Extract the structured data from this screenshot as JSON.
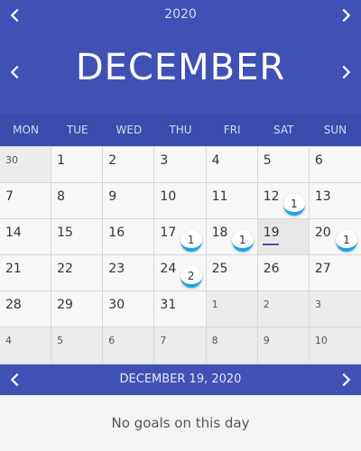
{
  "header": {
    "year": "2020",
    "month": "DECEMBER",
    "weekdays": [
      "MON",
      "TUE",
      "WED",
      "THU",
      "FRI",
      "SAT",
      "SUN"
    ]
  },
  "calendar": {
    "cells": [
      {
        "day": "30",
        "other": true
      },
      {
        "day": "1"
      },
      {
        "day": "2"
      },
      {
        "day": "3"
      },
      {
        "day": "4"
      },
      {
        "day": "5"
      },
      {
        "day": "6"
      },
      {
        "day": "7"
      },
      {
        "day": "8"
      },
      {
        "day": "9"
      },
      {
        "day": "10"
      },
      {
        "day": "11"
      },
      {
        "day": "12",
        "badge": "1"
      },
      {
        "day": "13"
      },
      {
        "day": "14"
      },
      {
        "day": "15"
      },
      {
        "day": "16"
      },
      {
        "day": "17",
        "badge": "1"
      },
      {
        "day": "18",
        "badge": "1"
      },
      {
        "day": "19",
        "selected": true
      },
      {
        "day": "20",
        "badge": "1"
      },
      {
        "day": "21"
      },
      {
        "day": "22"
      },
      {
        "day": "23"
      },
      {
        "day": "24",
        "badge": "2"
      },
      {
        "day": "25"
      },
      {
        "day": "26"
      },
      {
        "day": "27"
      },
      {
        "day": "28"
      },
      {
        "day": "29"
      },
      {
        "day": "30"
      },
      {
        "day": "31"
      },
      {
        "day": "1",
        "other": true
      },
      {
        "day": "2",
        "other": true
      },
      {
        "day": "3",
        "other": true
      },
      {
        "day": "4",
        "other": true
      },
      {
        "day": "5",
        "other": true
      },
      {
        "day": "6",
        "other": true
      },
      {
        "day": "7",
        "other": true
      },
      {
        "day": "8",
        "other": true
      },
      {
        "day": "9",
        "other": true
      },
      {
        "day": "10",
        "other": true
      }
    ]
  },
  "selected_date": {
    "label": "DECEMBER 19, 2020"
  },
  "goals": {
    "empty_text": "No goals on this day"
  },
  "icons": {
    "prev": "chevron-left-icon",
    "next": "chevron-right-icon"
  },
  "colors": {
    "primary": "#3f51b5",
    "badge_accent": "#1aa5e8",
    "selected_underline": "#3f51b5"
  }
}
